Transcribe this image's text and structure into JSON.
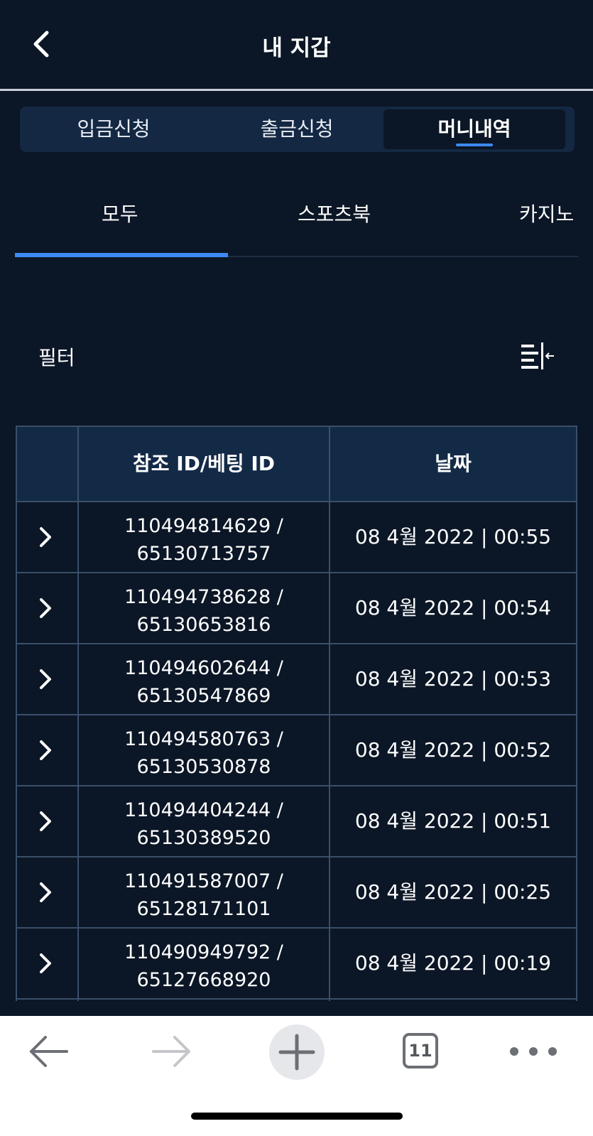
{
  "header": {
    "title": "내 지갑"
  },
  "segmented_tabs": [
    {
      "label": "입금신청",
      "active": false
    },
    {
      "label": "출금신청",
      "active": false
    },
    {
      "label": "머니내역",
      "active": true
    }
  ],
  "category_tabs": [
    {
      "label": "모두",
      "active": true
    },
    {
      "label": "스포츠북",
      "active": false
    },
    {
      "label": "카지노",
      "active": false
    }
  ],
  "filter": {
    "label": "필터"
  },
  "table": {
    "headers": [
      "참조 ID/베팅 ID",
      "날짜"
    ],
    "rows": [
      {
        "ref_id": "110494814629 /",
        "bet_id": "65130713757",
        "date": "08 4월 2022 | 00:55"
      },
      {
        "ref_id": "110494738628 /",
        "bet_id": "65130653816",
        "date": "08 4월 2022 | 00:54"
      },
      {
        "ref_id": "110494602644 /",
        "bet_id": "65130547869",
        "date": "08 4월 2022 | 00:53"
      },
      {
        "ref_id": "110494580763 /",
        "bet_id": "65130530878",
        "date": "08 4월 2022 | 00:52"
      },
      {
        "ref_id": "110494404244 /",
        "bet_id": "65130389520",
        "date": "08 4월 2022 | 00:51"
      },
      {
        "ref_id": "110491587007 /",
        "bet_id": "65128171101",
        "date": "08 4월 2022 | 00:25"
      },
      {
        "ref_id": "110490949792 /",
        "bet_id": "65127668920",
        "date": "08 4월 2022 | 00:19"
      }
    ]
  },
  "browser_toolbar": {
    "tab_count": "11",
    "icons": [
      "back-arrow-icon",
      "forward-arrow-icon",
      "plus-icon",
      "tabs-icon",
      "more-icon"
    ]
  },
  "colors": {
    "background": "#0b1626",
    "accent": "#3d8af7",
    "table_header": "#132a47",
    "grid_line": "#3a4f69"
  }
}
